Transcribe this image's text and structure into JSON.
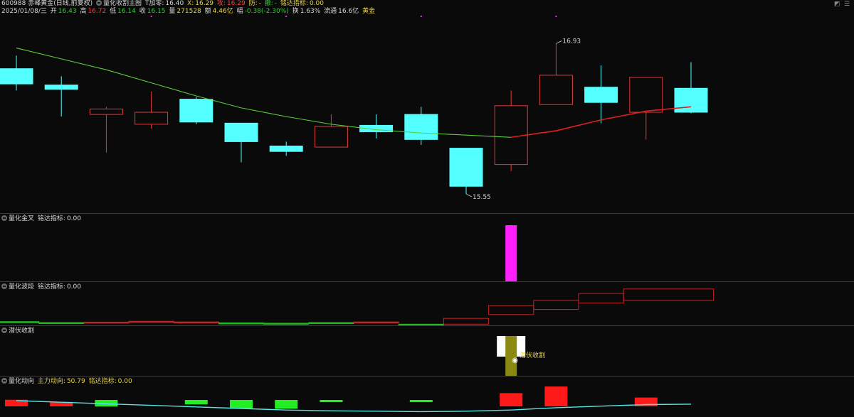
{
  "header": {
    "stock": "600988 赤峰黄金(日线,前复权)",
    "main_indicator": "量化收割主图",
    "t_add_label": "T加零:",
    "t_add_value": "16.40",
    "x_label": "X:",
    "x_value": "16.29",
    "attack_label": "攻:",
    "attack_value": "16.29",
    "defend_label": "防:",
    "defend_value": "-",
    "retreat_label": "撤:",
    "retreat_value": "-",
    "mingda_label": "铭达指标:",
    "mingda_value": "0.00"
  },
  "quote": {
    "date": "2025/01/08/三",
    "open_label": "开",
    "open": "16.43",
    "high_label": "高",
    "high": "16.72",
    "low_label": "低",
    "low": "16.14",
    "close_label": "收",
    "close": "16.15",
    "vol_label": "量",
    "vol": "271528",
    "amt_label": "额",
    "amt": "4.46亿",
    "chg_label": "幅",
    "chg": "-0.38(-2.30%)",
    "turnover_label": "换",
    "turnover": "1.63%",
    "float_label": "流通",
    "float": "16.6亿",
    "sector": "黄金"
  },
  "panels": {
    "p2": {
      "name": "量化金叉",
      "sub_label": "铭达指标:",
      "sub_value": "0.00"
    },
    "p3": {
      "name": "量化波段",
      "sub_label": "铭达指标:",
      "sub_value": "0.00"
    },
    "p4": {
      "name": "潜伏收割",
      "annotation": "潜伏收割"
    },
    "p5": {
      "name": "量化动向",
      "main_label": "主力动向:",
      "main_value": "50.79",
      "sub_label": "铭达指标:",
      "sub_value": "0.00"
    }
  },
  "colors": {
    "up_red": "#e03c3c",
    "down_cyan": "#54ffff",
    "ma_green": "#5acd3a",
    "ma_red": "#e02020",
    "magenta": "#ff1fff",
    "olive": "#8a8a10",
    "flow_line": "#55e6e6",
    "bar_green": "#22ee22",
    "bar_red": "#ff1a1a"
  },
  "chart_data": [
    {
      "type": "candlestick",
      "title": "600988 赤峰黄金(日线,前复权)",
      "ylim": [
        15.4,
        17.2
      ],
      "annotations": [
        {
          "text": "16.93",
          "value": 16.93,
          "index": 12
        },
        {
          "text": "15.55",
          "value": 15.55,
          "index": 10
        }
      ],
      "candles": [
        {
          "open": 16.7,
          "close": 16.56,
          "high": 16.82,
          "low": 16.5
        },
        {
          "open": 16.55,
          "close": 16.51,
          "high": 16.63,
          "low": 16.26
        },
        {
          "open": 16.28,
          "close": 16.33,
          "high": 16.35,
          "low": 15.93
        },
        {
          "open": 16.19,
          "close": 16.3,
          "high": 16.49,
          "low": 16.15
        },
        {
          "open": 16.42,
          "close": 16.21,
          "high": 16.44,
          "low": 16.19
        },
        {
          "open": 16.2,
          "close": 16.03,
          "high": 16.2,
          "low": 15.84
        },
        {
          "open": 15.99,
          "close": 15.94,
          "high": 16.03,
          "low": 15.9
        },
        {
          "open": 15.98,
          "close": 16.17,
          "high": 16.28,
          "low": 15.98
        },
        {
          "open": 16.18,
          "close": 16.12,
          "high": 16.28,
          "low": 16.06
        },
        {
          "open": 16.28,
          "close": 16.05,
          "high": 16.35,
          "low": 16.0
        },
        {
          "open": 15.97,
          "close": 15.62,
          "high": 15.97,
          "low": 15.55
        },
        {
          "open": 15.82,
          "close": 16.36,
          "high": 16.5,
          "low": 15.76
        },
        {
          "open": 16.37,
          "close": 16.64,
          "high": 16.93,
          "low": 16.37
        },
        {
          "open": 16.53,
          "close": 16.39,
          "high": 16.73,
          "low": 16.2
        },
        {
          "open": 16.3,
          "close": 16.62,
          "high": 16.62,
          "low": 16.05
        },
        {
          "open": 16.52,
          "close": 16.3,
          "high": 16.76,
          "low": 16.29
        }
      ],
      "ma": [
        16.89,
        16.79,
        16.69,
        16.57,
        16.45,
        16.34,
        16.26,
        16.19,
        16.14,
        16.11,
        16.09,
        16.07,
        16.13,
        16.23,
        16.31,
        16.35
      ]
    },
    {
      "type": "bar",
      "title": "量化金叉",
      "series": [
        {
          "values": [
            0,
            0,
            0,
            0,
            0,
            0,
            0,
            0,
            0,
            0,
            0,
            1,
            0,
            0,
            0,
            0
          ]
        }
      ]
    },
    {
      "type": "bar",
      "title": "量化波段",
      "ranges": [
        {
          "start": 0,
          "end": 1,
          "lo": 0.6,
          "hi": 0.7,
          "color": "green"
        },
        {
          "start": 1,
          "end": 2,
          "lo": 0.5,
          "hi": 0.55,
          "color": "green"
        },
        {
          "start": 2,
          "end": 3,
          "lo": 0.6,
          "hi": 0.62,
          "color": "red"
        },
        {
          "start": 3,
          "end": 4,
          "lo": 0.7,
          "hi": 0.75,
          "color": "red"
        },
        {
          "start": 4,
          "end": 5,
          "lo": 0.6,
          "hi": 0.65,
          "color": "red"
        },
        {
          "start": 5,
          "end": 6,
          "lo": 0.4,
          "hi": 0.5,
          "color": "green"
        },
        {
          "start": 6,
          "end": 7,
          "lo": 0.4,
          "hi": 0.45,
          "color": "green"
        },
        {
          "start": 7,
          "end": 8,
          "lo": 0.5,
          "hi": 0.55,
          "color": "green"
        },
        {
          "start": 8,
          "end": 9,
          "lo": 0.6,
          "hi": 0.65,
          "color": "red"
        },
        {
          "start": 9,
          "end": 10,
          "lo": 0.2,
          "hi": 0.3,
          "color": "green"
        },
        {
          "start": 10,
          "end": 11,
          "lo": 0.3,
          "hi": 1.2,
          "color": "red"
        },
        {
          "start": 11,
          "end": 12,
          "lo": 1.8,
          "hi": 3.2,
          "color": "red"
        },
        {
          "start": 12,
          "end": 13,
          "lo": 2.6,
          "hi": 4.0,
          "color": "red"
        },
        {
          "start": 13,
          "end": 14,
          "lo": 3.6,
          "hi": 5.1,
          "color": "red"
        },
        {
          "start": 14,
          "end": 16,
          "lo": 4.0,
          "hi": 5.8,
          "color": "red"
        }
      ]
    },
    {
      "type": "bar",
      "title": "潜伏收割",
      "series": [
        {
          "values": [
            0,
            0,
            0,
            0,
            0,
            0,
            0,
            0,
            0,
            0,
            0,
            1,
            0,
            0,
            0,
            0
          ]
        }
      ]
    },
    {
      "type": "bar",
      "title": "量化动向",
      "series": [
        {
          "name": "主力动向",
          "values": [
            60,
            56,
            52,
            48,
            44,
            40,
            36,
            34,
            33,
            32,
            33,
            36,
            42,
            46,
            50,
            51
          ]
        },
        {
          "values": [
            3,
            2,
            -3,
            0,
            -2,
            -4,
            -4,
            -1,
            0,
            -1,
            0,
            6,
            9,
            0,
            4,
            0
          ]
        }
      ]
    }
  ]
}
